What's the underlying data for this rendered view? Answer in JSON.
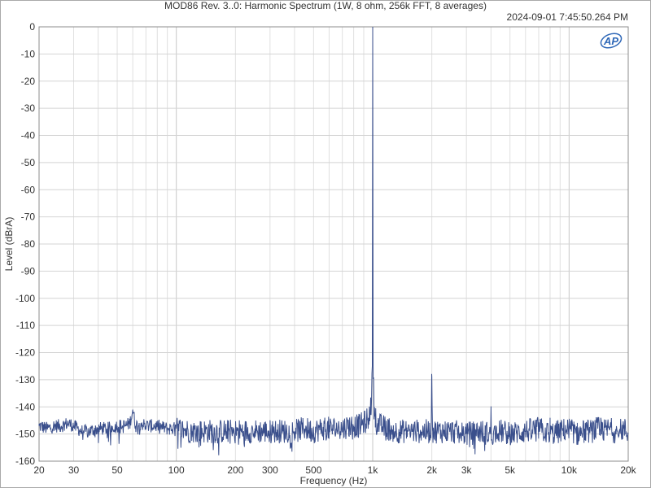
{
  "chart_data": {
    "type": "line",
    "title": "MOD86 Rev. 3..0: Harmonic Spectrum (1W, 8 ohm, 256k FFT, 8 averages)",
    "timestamp": "2024-09-01 7:45:50.264 PM",
    "xlabel": "Frequency (Hz)",
    "ylabel": "Level (dBrA)",
    "xscale": "log",
    "xlim": [
      20,
      20000
    ],
    "ylim": [
      -160,
      0
    ],
    "xticks": [
      {
        "v": 20,
        "label": "20"
      },
      {
        "v": 30,
        "label": "30"
      },
      {
        "v": 50,
        "label": "50"
      },
      {
        "v": 100,
        "label": "100"
      },
      {
        "v": 200,
        "label": "200"
      },
      {
        "v": 300,
        "label": "300"
      },
      {
        "v": 500,
        "label": "500"
      },
      {
        "v": 1000,
        "label": "1k"
      },
      {
        "v": 2000,
        "label": "2k"
      },
      {
        "v": 3000,
        "label": "3k"
      },
      {
        "v": 5000,
        "label": "5k"
      },
      {
        "v": 10000,
        "label": "10k"
      },
      {
        "v": 20000,
        "label": "20k"
      }
    ],
    "yticks": [
      0,
      -10,
      -20,
      -30,
      -40,
      -50,
      -60,
      -70,
      -80,
      -90,
      -100,
      -110,
      -120,
      -130,
      -140,
      -150,
      -160
    ],
    "grid": true,
    "line_color": "#3a4f8c",
    "logo_text": "AP",
    "series": [
      {
        "x": [
          20,
          22,
          24,
          26,
          28,
          30,
          33,
          36,
          40,
          45,
          50,
          55,
          58,
          60,
          62,
          66,
          70,
          80,
          90,
          100,
          120,
          150,
          180,
          200,
          250,
          300,
          350,
          400,
          450,
          500,
          550,
          600,
          650,
          700,
          750,
          800,
          850,
          900,
          930,
          950,
          970,
          985,
          995,
          1000,
          1005,
          1015,
          1030,
          1060,
          1100,
          1200,
          1300,
          1500,
          1700,
          1900,
          1980,
          2000,
          2020,
          2100,
          2500,
          2980,
          3000,
          3020,
          3500,
          3980,
          4000,
          4020,
          4500,
          5000,
          6000,
          7000,
          7990,
          8000,
          8010,
          9000,
          10000,
          11000,
          12000,
          13000,
          14000,
          15000,
          16000,
          17000,
          18000,
          19000,
          20000
        ],
        "y": [
          -147,
          -148,
          -147,
          -147,
          -146,
          -147,
          -149,
          -149,
          -148,
          -148,
          -147,
          -147,
          -146,
          -141,
          -147,
          -146,
          -147,
          -147,
          -148,
          -148,
          -149,
          -149,
          -149,
          -149,
          -149,
          -149,
          -149,
          -149,
          -148,
          -149,
          -148,
          -148,
          -148,
          -148,
          -147,
          -147,
          -147,
          -146,
          -145,
          -144,
          -142,
          -139,
          -125,
          0,
          -125,
          -140,
          -143,
          -146,
          -147,
          -148,
          -149,
          -149,
          -149,
          -149,
          -149,
          -129,
          -149,
          -149,
          -149,
          -150,
          -147,
          -150,
          -149,
          -150,
          -142,
          -150,
          -149,
          -150,
          -149,
          -148,
          -150,
          -144,
          -150,
          -149,
          -148,
          -150,
          -149,
          -149,
          -148,
          -149,
          -148,
          -149,
          -149,
          -148,
          -150
        ]
      }
    ]
  }
}
